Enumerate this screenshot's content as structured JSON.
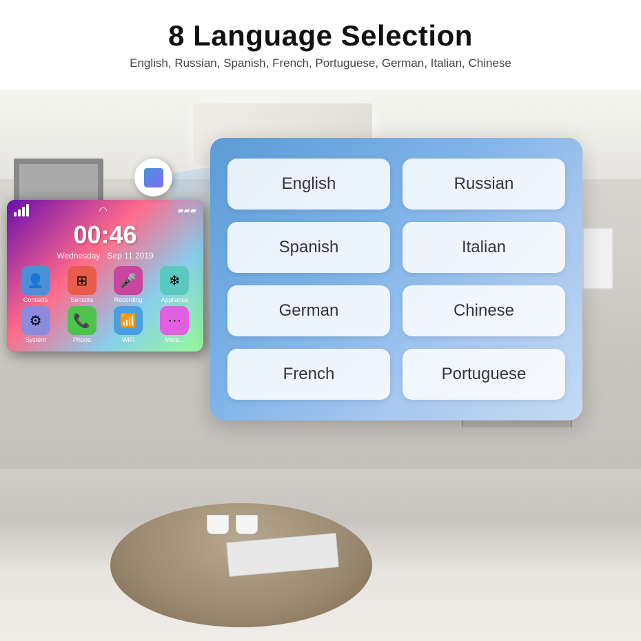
{
  "header": {
    "title": "8 Language Selection",
    "subtitle": "English, Russian, Spanish, French, Portuguese, German, Italian, Chinese"
  },
  "device": {
    "time": "00:46",
    "day": "Wednesday",
    "date": "Sep 11 2019",
    "apps": [
      {
        "label": "Contacts",
        "color": "#4a90d9",
        "icon": "👤"
      },
      {
        "label": "Sensors",
        "color": "#e85d4a",
        "icon": "⊞"
      },
      {
        "label": "Recording",
        "color": "#c945a0",
        "icon": "🎤"
      },
      {
        "label": "Appliance",
        "color": "#5bc8c0",
        "icon": "❄"
      },
      {
        "label": "System",
        "color": "#8a8adf",
        "icon": "⚙"
      },
      {
        "label": "Phone",
        "color": "#4bc44b",
        "icon": "📞"
      },
      {
        "label": "WiFi",
        "color": "#4a9fdf",
        "icon": "📶"
      },
      {
        "label": "More...",
        "color": "#e060e0",
        "icon": "···"
      }
    ]
  },
  "languages": [
    {
      "id": "english",
      "label": "English"
    },
    {
      "id": "russian",
      "label": "Russian"
    },
    {
      "id": "spanish",
      "label": "Spanish"
    },
    {
      "id": "italian",
      "label": "Italian"
    },
    {
      "id": "german",
      "label": "German"
    },
    {
      "id": "chinese",
      "label": "Chinese"
    },
    {
      "id": "french",
      "label": "French"
    },
    {
      "id": "portuguese",
      "label": "Portuguese"
    }
  ],
  "colors": {
    "card_gradient_start": "#5b9bd5",
    "card_gradient_end": "#c5daf5",
    "header_bg": "#ffffff",
    "title_color": "#111111",
    "subtitle_color": "#444444"
  }
}
